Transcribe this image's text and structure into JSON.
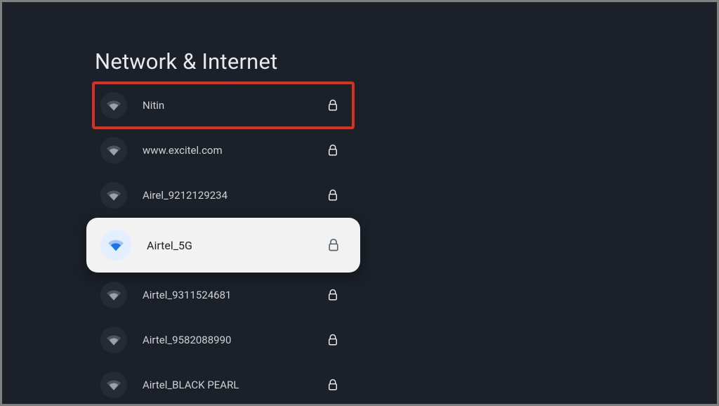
{
  "page_title": "Network & Internet",
  "networks": [
    {
      "ssid": "Nitin",
      "secured": true,
      "highlighted": true,
      "focused": false
    },
    {
      "ssid": "www.excitel.com",
      "secured": true,
      "highlighted": false,
      "focused": false
    },
    {
      "ssid": "Airel_9212129234",
      "secured": true,
      "highlighted": false,
      "focused": false
    },
    {
      "ssid": "Airtel_5G",
      "secured": true,
      "highlighted": false,
      "focused": true
    },
    {
      "ssid": "Airtel_9311524681",
      "secured": true,
      "highlighted": false,
      "focused": false
    },
    {
      "ssid": "Airtel_9582088990",
      "secured": true,
      "highlighted": false,
      "focused": false
    },
    {
      "ssid": "Airtel_BLACK PEARL",
      "secured": true,
      "highlighted": false,
      "focused": false
    }
  ],
  "colors": {
    "bg": "#1b2029",
    "text": "#cfd2d6",
    "focusedBg": "#f2f2f2",
    "focusedIconBg": "#e3efff",
    "focusedWifi": "#1a73e8",
    "highlight": "#d93025"
  }
}
